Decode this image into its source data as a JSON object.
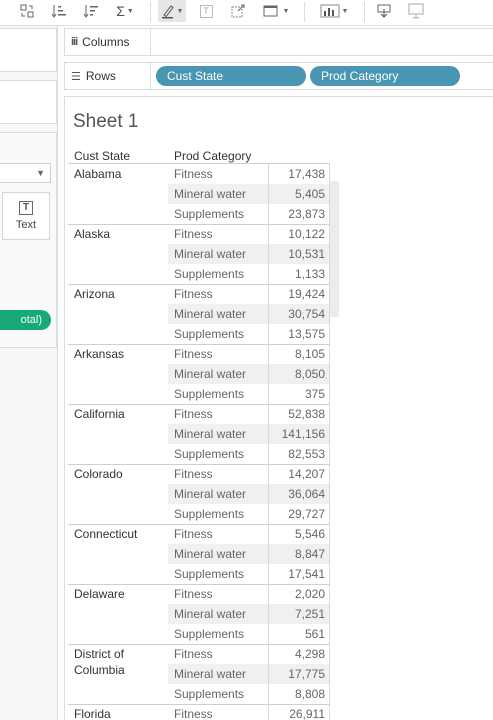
{
  "toolbar": {
    "icons": [
      "swap-rows-columns-icon",
      "sort-ascending-icon",
      "sort-descending-icon",
      "totals-icon",
      "highlight-icon",
      "text-label-icon",
      "fix-axes-icon",
      "fit-icon",
      "show-me-icon",
      "download-icon",
      "presentation-icon"
    ],
    "totals_symbol": "Σ",
    "text_symbol": "T"
  },
  "left_pane": {
    "marks_text_label": "Text",
    "marks_text_symbol": "T",
    "pill_text": "otal)",
    "pill_color": "#16a979"
  },
  "shelves": {
    "columns_label": "Columns",
    "rows_label": "Rows",
    "columns_icon": "iii",
    "rows_icon": "☰",
    "row_pills": [
      "Cust State",
      "Prod Category"
    ],
    "pill_color": "#4996b2"
  },
  "sheet": {
    "title": "Sheet 1",
    "header_state": "Cust State",
    "header_category": "Prod Category",
    "groups": [
      {
        "state": "Alabama",
        "rows": [
          {
            "cat": "Fitness",
            "val": "17,438"
          },
          {
            "cat": "Mineral water",
            "val": "5,405"
          },
          {
            "cat": "Supplements",
            "val": "23,873"
          }
        ]
      },
      {
        "state": "Alaska",
        "rows": [
          {
            "cat": "Fitness",
            "val": "10,122"
          },
          {
            "cat": "Mineral water",
            "val": "10,531"
          },
          {
            "cat": "Supplements",
            "val": "1,133"
          }
        ]
      },
      {
        "state": "Arizona",
        "rows": [
          {
            "cat": "Fitness",
            "val": "19,424"
          },
          {
            "cat": "Mineral water",
            "val": "30,754"
          },
          {
            "cat": "Supplements",
            "val": "13,575"
          }
        ]
      },
      {
        "state": "Arkansas",
        "rows": [
          {
            "cat": "Fitness",
            "val": "8,105"
          },
          {
            "cat": "Mineral water",
            "val": "8,050"
          },
          {
            "cat": "Supplements",
            "val": "375"
          }
        ]
      },
      {
        "state": "California",
        "rows": [
          {
            "cat": "Fitness",
            "val": "52,838"
          },
          {
            "cat": "Mineral water",
            "val": "141,156"
          },
          {
            "cat": "Supplements",
            "val": "82,553"
          }
        ]
      },
      {
        "state": "Colorado",
        "rows": [
          {
            "cat": "Fitness",
            "val": "14,207"
          },
          {
            "cat": "Mineral water",
            "val": "36,064"
          },
          {
            "cat": "Supplements",
            "val": "29,727"
          }
        ]
      },
      {
        "state": "Connecticut",
        "rows": [
          {
            "cat": "Fitness",
            "val": "5,546"
          },
          {
            "cat": "Mineral water",
            "val": "8,847"
          },
          {
            "cat": "Supplements",
            "val": "17,541"
          }
        ]
      },
      {
        "state": "Delaware",
        "rows": [
          {
            "cat": "Fitness",
            "val": "2,020"
          },
          {
            "cat": "Mineral water",
            "val": "7,251"
          },
          {
            "cat": "Supplements",
            "val": "561"
          }
        ]
      },
      {
        "state": "District of Columbia",
        "rows": [
          {
            "cat": "Fitness",
            "val": "4,298"
          },
          {
            "cat": "Mineral water",
            "val": "17,775"
          },
          {
            "cat": "Supplements",
            "val": "8,808"
          }
        ]
      },
      {
        "state": "Florida",
        "rows": [
          {
            "cat": "Fitness",
            "val": "26,911"
          }
        ]
      }
    ]
  }
}
